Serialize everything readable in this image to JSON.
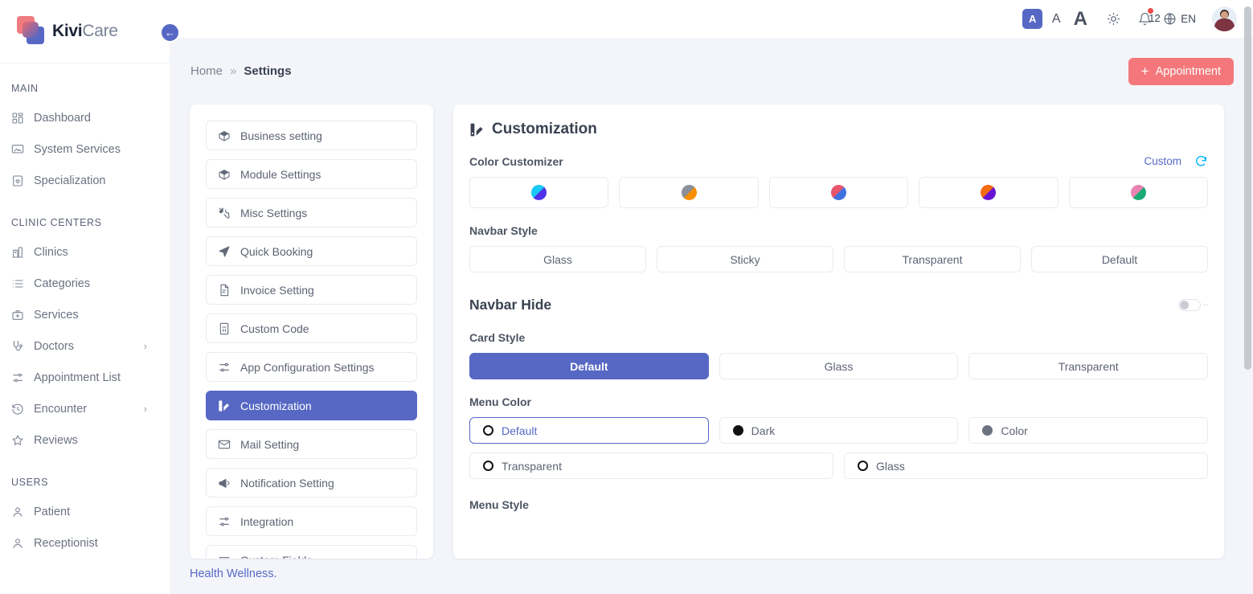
{
  "brand": {
    "name_bold": "Kivi",
    "name_light": "Care"
  },
  "sidebar": {
    "collapse_icon": "arrow-left-icon",
    "sections": [
      {
        "title": "MAIN",
        "items": [
          {
            "label": "Dashboard",
            "icon": "grid-icon",
            "chevron": false
          },
          {
            "label": "System Services",
            "icon": "monitor-icon",
            "chevron": false
          },
          {
            "label": "Specialization",
            "icon": "badge-heart-icon",
            "chevron": false
          }
        ]
      },
      {
        "title": "CLINIC CENTERS",
        "items": [
          {
            "label": "Clinics",
            "icon": "hospital-icon",
            "chevron": false
          },
          {
            "label": "Categories",
            "icon": "list-icon",
            "chevron": false
          },
          {
            "label": "Services",
            "icon": "medical-bag-icon",
            "chevron": false
          },
          {
            "label": "Doctors",
            "icon": "stethoscope-icon",
            "chevron": true
          },
          {
            "label": "Appointment List",
            "icon": "sliders-icon",
            "chevron": false
          },
          {
            "label": "Encounter",
            "icon": "history-icon",
            "chevron": true
          },
          {
            "label": "Reviews",
            "icon": "star-icon",
            "chevron": false
          }
        ]
      },
      {
        "title": "USERS",
        "items": [
          {
            "label": "Patient",
            "icon": "user-icon",
            "chevron": false
          },
          {
            "label": "Receptionist",
            "icon": "user-icon",
            "chevron": false
          }
        ]
      }
    ]
  },
  "topbar": {
    "font_small": "A",
    "font_medium": "A",
    "font_large": "A",
    "theme_icon": "sun-icon",
    "notification_icon": "bell-icon",
    "notification_count": "12",
    "language_icon": "globe-icon",
    "language": "EN",
    "avatar": "user-avatar"
  },
  "breadcrumb": {
    "home": "Home",
    "separator": "»",
    "current": "Settings"
  },
  "appointment_button": {
    "label": "Appointment",
    "icon": "plus-icon",
    "color": "#f4787b"
  },
  "settings_menu": {
    "items": [
      {
        "label": "Business setting",
        "icon": "box-icon",
        "active": false
      },
      {
        "label": "Module Settings",
        "icon": "box-icon",
        "active": false
      },
      {
        "label": "Misc Settings",
        "icon": "tools-icon",
        "active": false
      },
      {
        "label": "Quick Booking",
        "icon": "send-icon",
        "active": false
      },
      {
        "label": "Invoice Setting",
        "icon": "invoice-icon",
        "active": false
      },
      {
        "label": "Custom Code",
        "icon": "code-file-icon",
        "active": false
      },
      {
        "label": "App Configuration Settings",
        "icon": "sliders-icon",
        "active": false
      },
      {
        "label": "Customization",
        "icon": "customization-icon",
        "active": true
      },
      {
        "label": "Mail Setting",
        "icon": "envelope-icon",
        "active": false
      },
      {
        "label": "Notification Setting",
        "icon": "megaphone-icon",
        "active": false
      },
      {
        "label": "Integration",
        "icon": "sliders-icon",
        "active": false
      },
      {
        "label": "Custom Fields",
        "icon": "lines-icon",
        "active": false
      }
    ]
  },
  "customization": {
    "title": "Customization",
    "title_icon": "customization-icon",
    "color_customizer": {
      "label": "Color Customizer",
      "custom_link": "Custom",
      "reset_icon": "refresh-icon",
      "reset_color": "#00b3ff",
      "swatches": [
        {
          "name": "cyan-blue",
          "from": "#18c8f5",
          "to": "#4e31e8"
        },
        {
          "name": "gray-orange",
          "from": "#8a8f99",
          "to": "#f78e00"
        },
        {
          "name": "red-blue",
          "from": "#e8556d",
          "to": "#3f72e0"
        },
        {
          "name": "orange-purple",
          "from": "#f46a0f",
          "to": "#6813d4"
        },
        {
          "name": "pink-green",
          "from": "#ea83b4",
          "to": "#19ab74"
        }
      ]
    },
    "navbar_style": {
      "label": "Navbar Style",
      "options": [
        {
          "label": "Glass",
          "selected": false
        },
        {
          "label": "Sticky",
          "selected": false
        },
        {
          "label": "Transparent",
          "selected": false
        },
        {
          "label": "Default",
          "selected": false
        }
      ]
    },
    "navbar_hide": {
      "label": "Navbar Hide",
      "enabled": false
    },
    "card_style": {
      "label": "Card Style",
      "options": [
        {
          "label": "Default",
          "selected": true
        },
        {
          "label": "Glass",
          "selected": false
        },
        {
          "label": "Transparent",
          "selected": false
        }
      ]
    },
    "menu_color": {
      "label": "Menu Color",
      "options": [
        {
          "label": "Default",
          "marker": "ring",
          "selected": true
        },
        {
          "label": "Dark",
          "marker": "solid-black",
          "selected": false
        },
        {
          "label": "Color",
          "marker": "solid-gray",
          "selected": false
        },
        {
          "label": "Transparent",
          "marker": "ring",
          "selected": false
        },
        {
          "label": "Glass",
          "marker": "ring",
          "selected": false
        }
      ]
    },
    "menu_style": {
      "label": "Menu Style"
    }
  },
  "footer": {
    "link": "Health Wellness."
  }
}
